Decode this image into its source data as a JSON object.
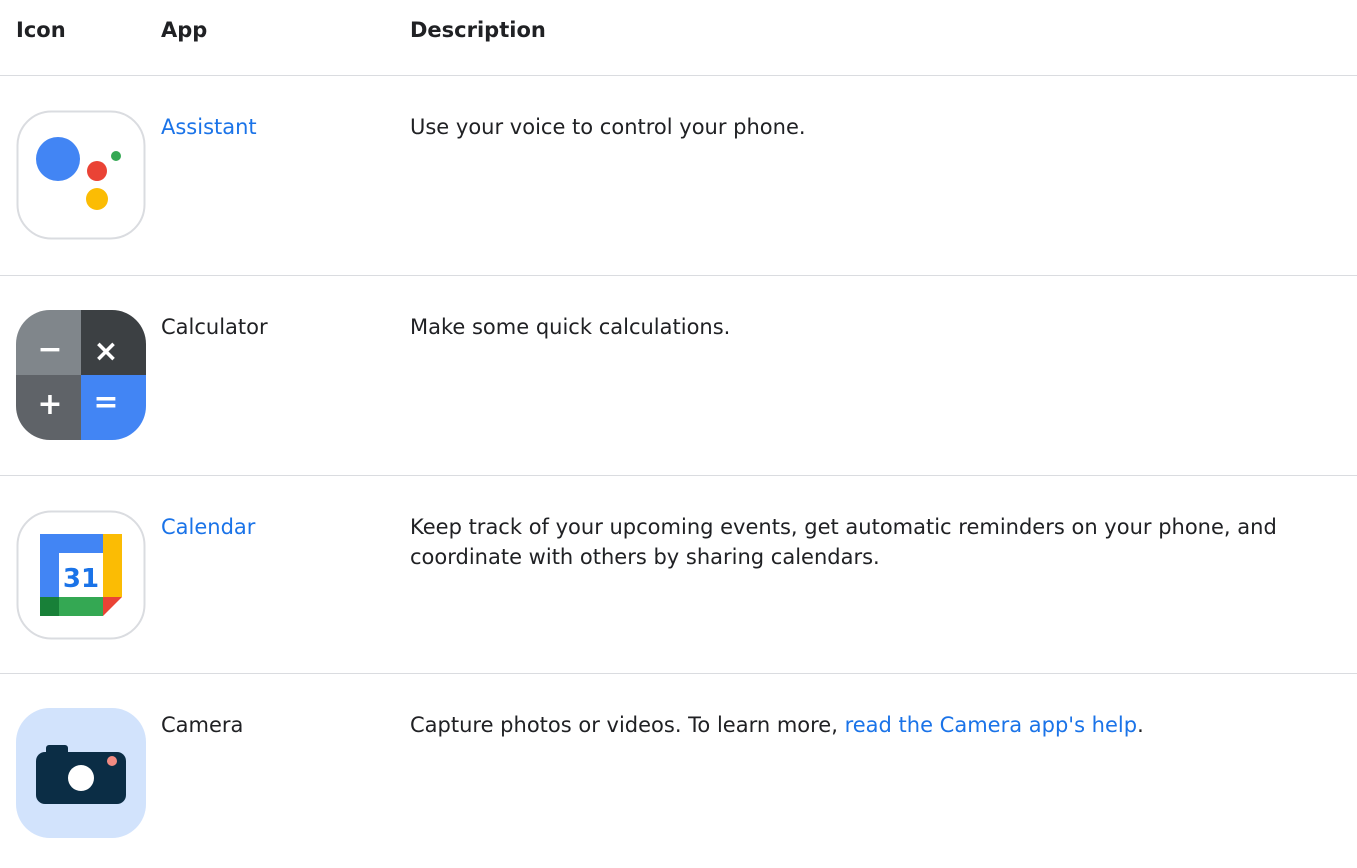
{
  "table": {
    "headers": {
      "icon": "Icon",
      "app": "App",
      "description": "Description"
    },
    "rows": [
      {
        "icon": "assistant-icon",
        "app": "Assistant",
        "app_is_link": true,
        "description": "Use your voice to control your phone."
      },
      {
        "icon": "calculator-icon",
        "app": "Calculator",
        "app_is_link": false,
        "description": "Make some quick calculations.",
        "icon_glyphs": {
          "minus": "−",
          "times": "×",
          "plus": "+",
          "equals": "="
        }
      },
      {
        "icon": "calendar-icon",
        "app": "Calendar",
        "app_is_link": true,
        "description": "Keep track of your upcoming events, get automatic reminders on your phone, and coordinate with others by sharing calendars.",
        "icon_text": "31"
      },
      {
        "icon": "camera-icon",
        "app": "Camera",
        "app_is_link": false,
        "description_prefix": "Capture photos or videos. To learn more, ",
        "description_link": "read the Camera app's help",
        "description_suffix": "."
      }
    ]
  },
  "colors": {
    "link": "#1a73e8",
    "text": "#202124",
    "divider": "#dadce0",
    "google_blue": "#4285f4",
    "google_red": "#ea4335",
    "google_yellow": "#fbbc04",
    "google_green": "#34a853"
  }
}
